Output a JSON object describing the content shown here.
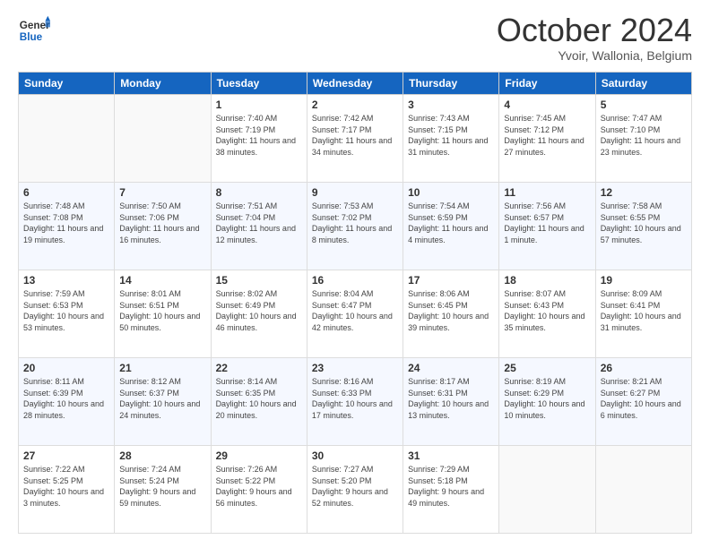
{
  "header": {
    "logo_general": "General",
    "logo_blue": "Blue",
    "month_title": "October 2024",
    "location": "Yvoir, Wallonia, Belgium"
  },
  "days_of_week": [
    "Sunday",
    "Monday",
    "Tuesday",
    "Wednesday",
    "Thursday",
    "Friday",
    "Saturday"
  ],
  "weeks": [
    [
      {
        "day": "",
        "sunrise": "",
        "sunset": "",
        "daylight": ""
      },
      {
        "day": "",
        "sunrise": "",
        "sunset": "",
        "daylight": ""
      },
      {
        "day": "1",
        "sunrise": "Sunrise: 7:40 AM",
        "sunset": "Sunset: 7:19 PM",
        "daylight": "Daylight: 11 hours and 38 minutes."
      },
      {
        "day": "2",
        "sunrise": "Sunrise: 7:42 AM",
        "sunset": "Sunset: 7:17 PM",
        "daylight": "Daylight: 11 hours and 34 minutes."
      },
      {
        "day": "3",
        "sunrise": "Sunrise: 7:43 AM",
        "sunset": "Sunset: 7:15 PM",
        "daylight": "Daylight: 11 hours and 31 minutes."
      },
      {
        "day": "4",
        "sunrise": "Sunrise: 7:45 AM",
        "sunset": "Sunset: 7:12 PM",
        "daylight": "Daylight: 11 hours and 27 minutes."
      },
      {
        "day": "5",
        "sunrise": "Sunrise: 7:47 AM",
        "sunset": "Sunset: 7:10 PM",
        "daylight": "Daylight: 11 hours and 23 minutes."
      }
    ],
    [
      {
        "day": "6",
        "sunrise": "Sunrise: 7:48 AM",
        "sunset": "Sunset: 7:08 PM",
        "daylight": "Daylight: 11 hours and 19 minutes."
      },
      {
        "day": "7",
        "sunrise": "Sunrise: 7:50 AM",
        "sunset": "Sunset: 7:06 PM",
        "daylight": "Daylight: 11 hours and 16 minutes."
      },
      {
        "day": "8",
        "sunrise": "Sunrise: 7:51 AM",
        "sunset": "Sunset: 7:04 PM",
        "daylight": "Daylight: 11 hours and 12 minutes."
      },
      {
        "day": "9",
        "sunrise": "Sunrise: 7:53 AM",
        "sunset": "Sunset: 7:02 PM",
        "daylight": "Daylight: 11 hours and 8 minutes."
      },
      {
        "day": "10",
        "sunrise": "Sunrise: 7:54 AM",
        "sunset": "Sunset: 6:59 PM",
        "daylight": "Daylight: 11 hours and 4 minutes."
      },
      {
        "day": "11",
        "sunrise": "Sunrise: 7:56 AM",
        "sunset": "Sunset: 6:57 PM",
        "daylight": "Daylight: 11 hours and 1 minute."
      },
      {
        "day": "12",
        "sunrise": "Sunrise: 7:58 AM",
        "sunset": "Sunset: 6:55 PM",
        "daylight": "Daylight: 10 hours and 57 minutes."
      }
    ],
    [
      {
        "day": "13",
        "sunrise": "Sunrise: 7:59 AM",
        "sunset": "Sunset: 6:53 PM",
        "daylight": "Daylight: 10 hours and 53 minutes."
      },
      {
        "day": "14",
        "sunrise": "Sunrise: 8:01 AM",
        "sunset": "Sunset: 6:51 PM",
        "daylight": "Daylight: 10 hours and 50 minutes."
      },
      {
        "day": "15",
        "sunrise": "Sunrise: 8:02 AM",
        "sunset": "Sunset: 6:49 PM",
        "daylight": "Daylight: 10 hours and 46 minutes."
      },
      {
        "day": "16",
        "sunrise": "Sunrise: 8:04 AM",
        "sunset": "Sunset: 6:47 PM",
        "daylight": "Daylight: 10 hours and 42 minutes."
      },
      {
        "day": "17",
        "sunrise": "Sunrise: 8:06 AM",
        "sunset": "Sunset: 6:45 PM",
        "daylight": "Daylight: 10 hours and 39 minutes."
      },
      {
        "day": "18",
        "sunrise": "Sunrise: 8:07 AM",
        "sunset": "Sunset: 6:43 PM",
        "daylight": "Daylight: 10 hours and 35 minutes."
      },
      {
        "day": "19",
        "sunrise": "Sunrise: 8:09 AM",
        "sunset": "Sunset: 6:41 PM",
        "daylight": "Daylight: 10 hours and 31 minutes."
      }
    ],
    [
      {
        "day": "20",
        "sunrise": "Sunrise: 8:11 AM",
        "sunset": "Sunset: 6:39 PM",
        "daylight": "Daylight: 10 hours and 28 minutes."
      },
      {
        "day": "21",
        "sunrise": "Sunrise: 8:12 AM",
        "sunset": "Sunset: 6:37 PM",
        "daylight": "Daylight: 10 hours and 24 minutes."
      },
      {
        "day": "22",
        "sunrise": "Sunrise: 8:14 AM",
        "sunset": "Sunset: 6:35 PM",
        "daylight": "Daylight: 10 hours and 20 minutes."
      },
      {
        "day": "23",
        "sunrise": "Sunrise: 8:16 AM",
        "sunset": "Sunset: 6:33 PM",
        "daylight": "Daylight: 10 hours and 17 minutes."
      },
      {
        "day": "24",
        "sunrise": "Sunrise: 8:17 AM",
        "sunset": "Sunset: 6:31 PM",
        "daylight": "Daylight: 10 hours and 13 minutes."
      },
      {
        "day": "25",
        "sunrise": "Sunrise: 8:19 AM",
        "sunset": "Sunset: 6:29 PM",
        "daylight": "Daylight: 10 hours and 10 minutes."
      },
      {
        "day": "26",
        "sunrise": "Sunrise: 8:21 AM",
        "sunset": "Sunset: 6:27 PM",
        "daylight": "Daylight: 10 hours and 6 minutes."
      }
    ],
    [
      {
        "day": "27",
        "sunrise": "Sunrise: 7:22 AM",
        "sunset": "Sunset: 5:25 PM",
        "daylight": "Daylight: 10 hours and 3 minutes."
      },
      {
        "day": "28",
        "sunrise": "Sunrise: 7:24 AM",
        "sunset": "Sunset: 5:24 PM",
        "daylight": "Daylight: 9 hours and 59 minutes."
      },
      {
        "day": "29",
        "sunrise": "Sunrise: 7:26 AM",
        "sunset": "Sunset: 5:22 PM",
        "daylight": "Daylight: 9 hours and 56 minutes."
      },
      {
        "day": "30",
        "sunrise": "Sunrise: 7:27 AM",
        "sunset": "Sunset: 5:20 PM",
        "daylight": "Daylight: 9 hours and 52 minutes."
      },
      {
        "day": "31",
        "sunrise": "Sunrise: 7:29 AM",
        "sunset": "Sunset: 5:18 PM",
        "daylight": "Daylight: 9 hours and 49 minutes."
      },
      {
        "day": "",
        "sunrise": "",
        "sunset": "",
        "daylight": ""
      },
      {
        "day": "",
        "sunrise": "",
        "sunset": "",
        "daylight": ""
      }
    ]
  ]
}
